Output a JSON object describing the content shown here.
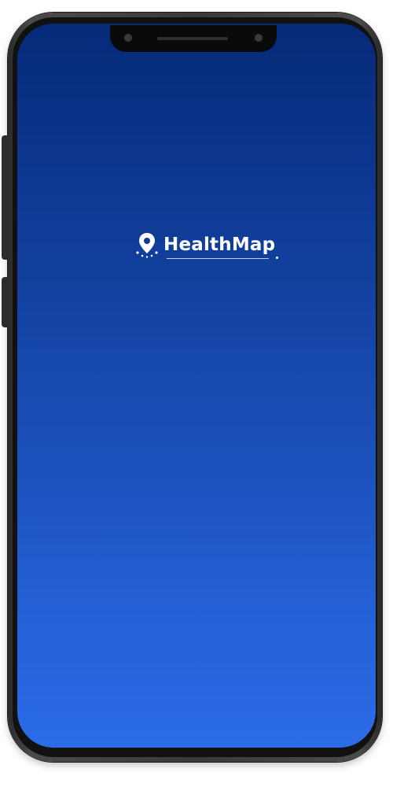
{
  "app": {
    "brand_name": "HealthMap",
    "logo_icon": "map-pin-icon"
  },
  "colors": {
    "screen_gradient_top": "#062a78",
    "screen_gradient_bottom": "#2c6ce8",
    "brand_text": "#ffffff",
    "device_frame": "#3a3a3a"
  }
}
